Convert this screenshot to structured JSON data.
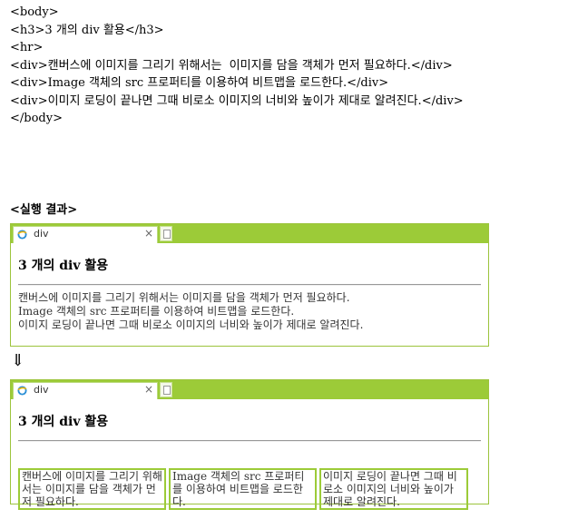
{
  "code_lines": [
    "<body>",
    "<h3>3 개의 div 활용</h3>",
    "<hr>",
    "<div>캔버스에 이미지를 그리기 위해서는  이미지를 담을 객체가 먼저 필요하다.</div>",
    "<div>Image 객체의 src 프로퍼티를 이용하여 비트맵을 로드한다.</div>",
    "<div>이미지 로딩이 끝나면 그때 비로소 이미지의 너비와 높이가 제대로 알려진다.</div>",
    "</body>"
  ],
  "result_heading": "<실행 결과>",
  "browser_tab": {
    "title": "div",
    "close": "×"
  },
  "page": {
    "heading": "3 개의 div 활용",
    "line1": "캔버스에 이미지를 그리기 위해서는 이미지를 담을 객체가 먼저 필요하다.",
    "line2_latin": "Image",
    "line2_mid": " 객체의 ",
    "line2_src": "src",
    "line2_rest": " 프로퍼티를 이용하여 비트맵을 로드한다.",
    "line3": "이미지 로딩이 끝나면 그때 비로소 이미지의 너비와 높이가 제대로 알려진다."
  },
  "arrow": "⇓",
  "colors": {
    "accent": "#9ccb38"
  }
}
